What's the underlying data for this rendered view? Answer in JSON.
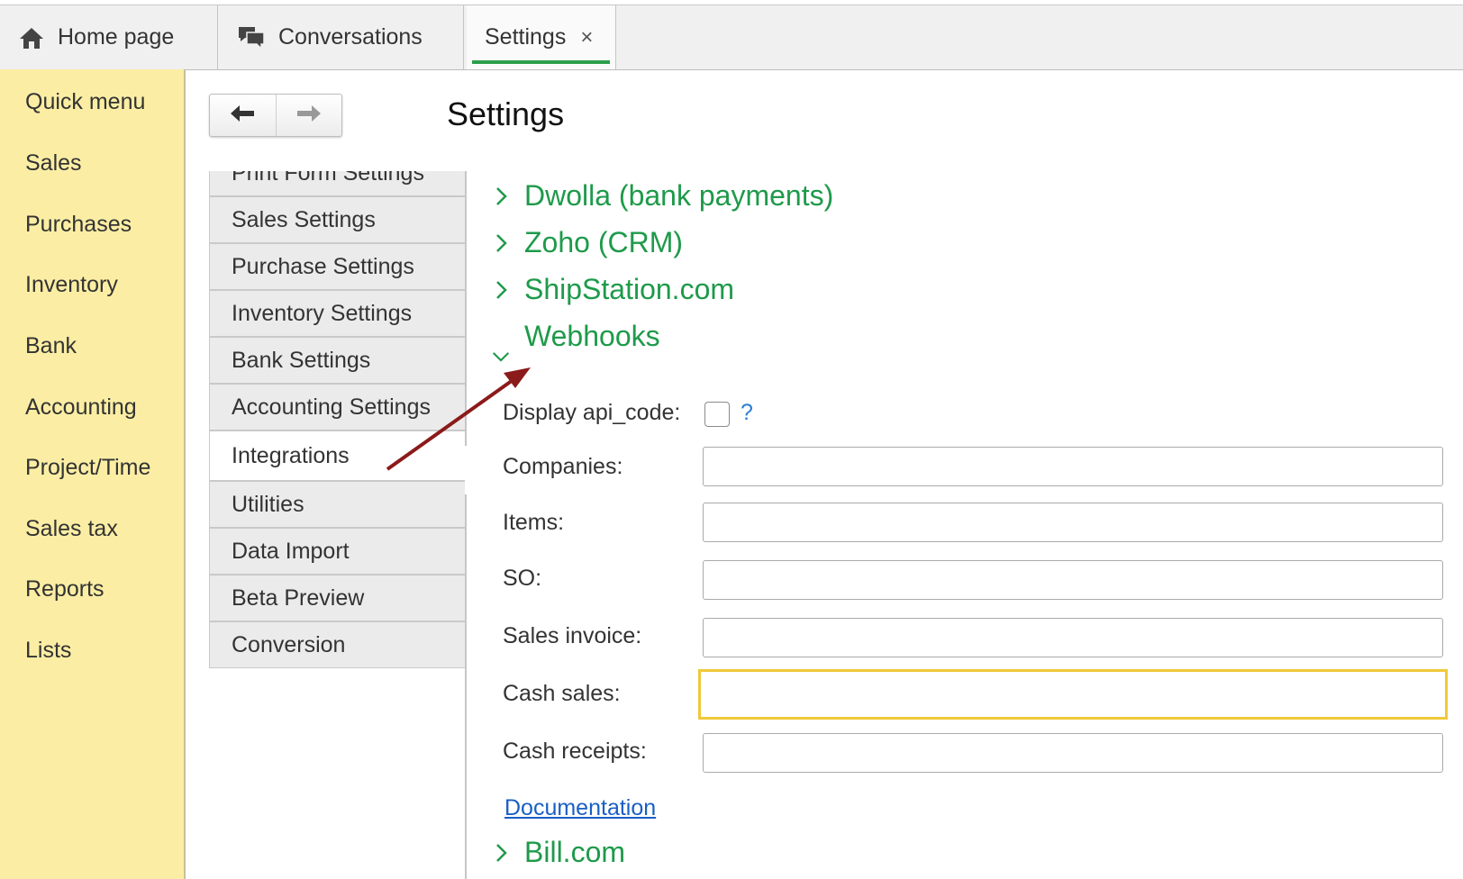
{
  "tabs": {
    "home": "Home page",
    "conversations": "Conversations",
    "settings": "Settings",
    "close": "×"
  },
  "sidebar": {
    "items": [
      "Quick menu",
      "Sales",
      "Purchases",
      "Inventory",
      "Bank",
      "Accounting",
      "Project/Time",
      "Sales tax",
      "Reports",
      "Lists"
    ]
  },
  "page": {
    "title": "Settings"
  },
  "settings_menu": {
    "items": [
      "Print Form Settings",
      "Sales Settings",
      "Purchase Settings",
      "Inventory Settings",
      "Bank Settings",
      "Accounting Settings",
      "Integrations",
      "Utilities",
      "Data Import",
      "Beta Preview",
      "Conversion"
    ],
    "active": "Integrations"
  },
  "integrations": {
    "sections": [
      "Dwolla (bank payments)",
      "Zoho (CRM)",
      "ShipStation.com",
      "Webhooks",
      "Bill.com"
    ],
    "webhooks": {
      "display_api_code_label": "Display api_code:",
      "help": "?",
      "fields": [
        "Companies:",
        "Items:",
        "SO:",
        "Sales invoice:",
        "Cash sales:",
        "Cash receipts:"
      ],
      "doc_link": "Documentation"
    }
  },
  "colors": {
    "accent": "#1e9a4a",
    "sidebar": "#fbeea4",
    "focus": "#f0c93a",
    "annotation_arrow": "#8b1a1a"
  }
}
